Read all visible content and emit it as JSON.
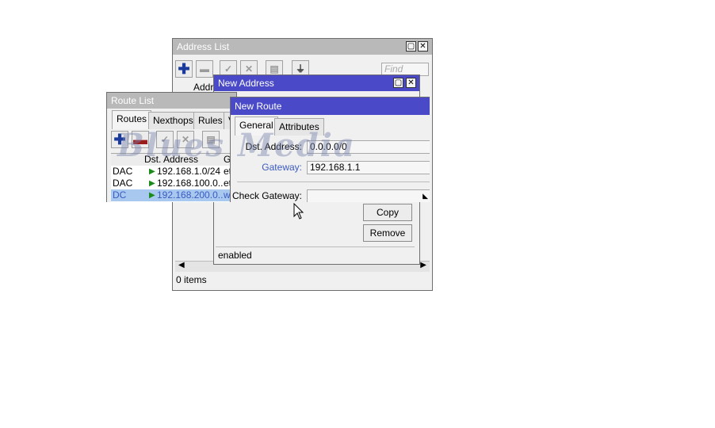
{
  "address_list": {
    "title": "Address List",
    "find_placeholder": "Find",
    "column_partial": "Addre",
    "status": "0 items"
  },
  "new_address": {
    "title": "New Address",
    "copy_label": "Copy",
    "remove_label": "Remove",
    "status": "enabled"
  },
  "route_list": {
    "title": "Route List",
    "tabs": [
      "Routes",
      "Nexthops",
      "Rules",
      "V"
    ],
    "header_dst": "Dst. Address",
    "header_gw": "G",
    "rows": [
      {
        "flags": "DAC",
        "dst": "192.168.1.0/24",
        "gw": "et"
      },
      {
        "flags": "DAC",
        "dst": "192.168.100.0...",
        "gw": "et"
      },
      {
        "flags": "DC",
        "dst": "192.168.200.0...",
        "gw": "wl"
      }
    ]
  },
  "new_route": {
    "title": "New Route",
    "tabs": [
      "General",
      "Attributes"
    ],
    "dst_label": "Dst. Address:",
    "dst_value": "0.0.0.0/0",
    "gateway_label": "Gateway:",
    "gateway_value": "192.168.1.1",
    "check_gateway_label": "Check Gateway:"
  },
  "watermark": "Blues Media",
  "colors": {
    "active_title": "#4a4ac8",
    "inactive_title": "#b9b9b9",
    "selected_row": "#a8c8f0"
  }
}
